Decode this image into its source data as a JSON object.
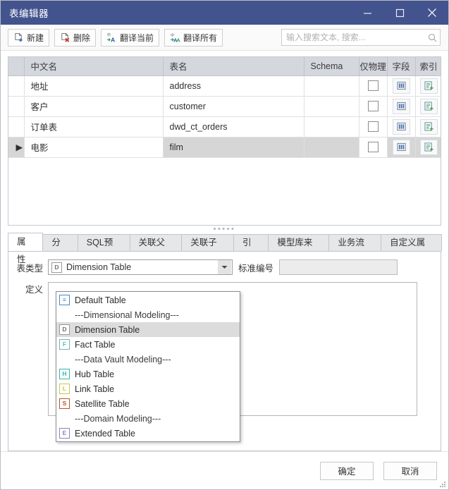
{
  "window": {
    "title": "表编辑器",
    "minimize_label": "最小化",
    "maximize_label": "最大化",
    "close_label": "关闭",
    "accent_color": "#43538e"
  },
  "toolbar": {
    "buttons": [
      {
        "label": "新建",
        "icon": "new-file-icon"
      },
      {
        "label": "删除",
        "icon": "delete-file-icon"
      },
      {
        "label": "翻译当前",
        "icon": "translate-current-icon"
      },
      {
        "label": "翻译所有",
        "icon": "translate-all-icon"
      }
    ],
    "search": {
      "value": "",
      "placeholder": "输入搜索文本, 搜索...",
      "icon": "search-icon"
    }
  },
  "grid": {
    "columns": [
      "中文名",
      "表名",
      "Schema",
      "仅物理",
      "字段",
      "索引"
    ],
    "rows": [
      {
        "indicator": "",
        "cn_name": "地址",
        "table_name": "address",
        "schema": "",
        "physical_only": false,
        "selected": false
      },
      {
        "indicator": "",
        "cn_name": "客户",
        "table_name": "customer",
        "schema": "",
        "physical_only": false,
        "selected": false
      },
      {
        "indicator": "",
        "cn_name": "订单表",
        "table_name": "dwd_ct_orders",
        "schema": "",
        "physical_only": false,
        "selected": false
      },
      {
        "indicator": "▶",
        "cn_name": "电影",
        "table_name": "film",
        "schema": "",
        "physical_only": false,
        "selected": true
      }
    ],
    "field_icon": "columns-icon",
    "index_icon": "index-add-icon",
    "field_icon_color": "#4a74b0",
    "index_icon_color": "#4f8f85"
  },
  "splitter": {
    "dots": "•••••"
  },
  "tabs": [
    {
      "label": "属性",
      "active": true
    },
    {
      "label": "分区",
      "active": false
    },
    {
      "label": "SQL预览",
      "active": false
    },
    {
      "label": "关联父表",
      "active": false
    },
    {
      "label": "关联子表",
      "active": false
    },
    {
      "label": "引用",
      "active": false
    },
    {
      "label": "模型库来源",
      "active": false
    },
    {
      "label": "业务流程",
      "active": false
    },
    {
      "label": "自定义属性",
      "active": false
    }
  ],
  "properties": {
    "table_type_label": "表类型",
    "table_type_value": "Dimension Table",
    "table_type_icon": "dimension-table-icon",
    "std_no_label": "标准编号",
    "std_no_value": "",
    "definition_label": "定义",
    "definition_value": ""
  },
  "dropdown": {
    "open": true,
    "items": [
      {
        "label": "Default Table",
        "type": "item",
        "badge": "≡",
        "color": "#4a86c8",
        "selected": false
      },
      {
        "label": "---Dimensional Modeling---",
        "type": "group"
      },
      {
        "label": "Dimension Table",
        "type": "item",
        "badge": "D",
        "color": "#7a7a7a",
        "selected": true
      },
      {
        "label": "Fact Table",
        "type": "item",
        "badge": "F",
        "color": "#6fb8b0",
        "selected": false
      },
      {
        "label": "---Data Vault Modeling---",
        "type": "group"
      },
      {
        "label": "Hub Table",
        "type": "item",
        "badge": "H",
        "color": "#35b8a8",
        "selected": false
      },
      {
        "label": "Link Table",
        "type": "item",
        "badge": "L",
        "color": "#c8c84a",
        "selected": false
      },
      {
        "label": "Satellite Table",
        "type": "item",
        "badge": "S",
        "color": "#b4562a",
        "selected": false
      },
      {
        "label": "---Domain Modeling---",
        "type": "group"
      },
      {
        "label": "Extended Table",
        "type": "item",
        "badge": "E",
        "color": "#8f7fc4",
        "selected": false
      }
    ]
  },
  "footer": {
    "ok_label": "确定",
    "cancel_label": "取消"
  }
}
